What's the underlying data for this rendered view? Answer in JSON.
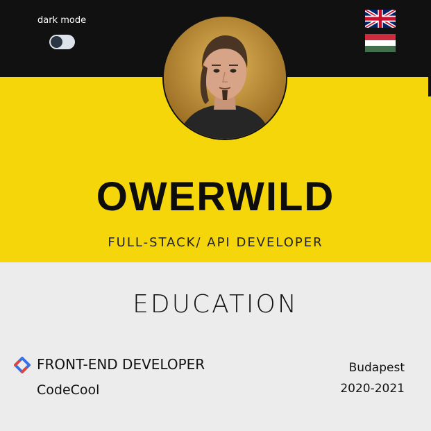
{
  "theme": {
    "dark_bar_color": "#111111",
    "accent_color": "#f5d60a",
    "section_bg_color": "#ececec"
  },
  "header": {
    "dark_mode_label": "dark mode",
    "dark_mode_on": false,
    "languages": [
      {
        "name": "English",
        "icon": "uk-flag-icon"
      },
      {
        "name": "Hungarian",
        "icon": "hungary-flag-icon"
      }
    ]
  },
  "hero": {
    "title": "OWERWILD",
    "subtitle": "FULL-STACK/ API DEVELOPER",
    "avatar_icon": "profile-photo"
  },
  "education": {
    "section_title": "EDUCATION",
    "entries": [
      {
        "role": "FRONT-END DEVELOPER",
        "school": "CodeCool",
        "city": "Budapest",
        "years": "2020-2021",
        "icon": "codecool-logo-icon"
      }
    ]
  }
}
